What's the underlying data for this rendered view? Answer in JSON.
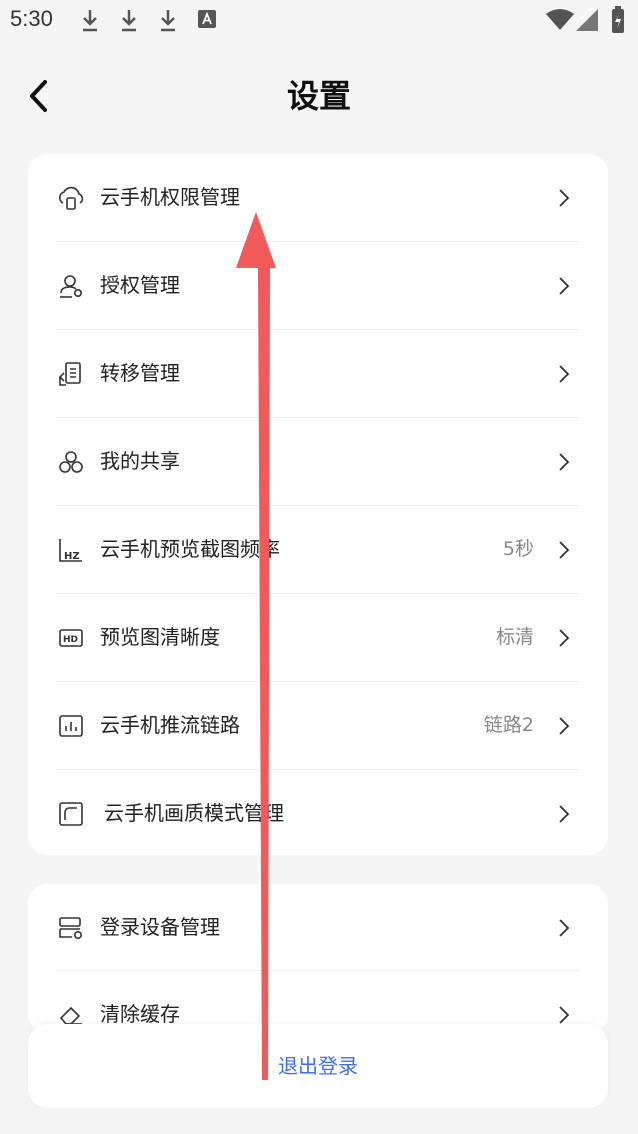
{
  "status_bar": {
    "time": "5:30",
    "icons": [
      "download-icon",
      "download-icon",
      "download-icon",
      "a-badge-icon",
      "wifi-icon",
      "signal-icon",
      "battery-icon"
    ]
  },
  "header": {
    "title": "设置",
    "back_icon": "chevron-left-icon"
  },
  "settings_group_1": [
    {
      "icon": "cloud-phone-icon",
      "label": "云手机权限管理",
      "value": ""
    },
    {
      "icon": "user-settings-icon",
      "label": "授权管理",
      "value": ""
    },
    {
      "icon": "transfer-icon",
      "label": "转移管理",
      "value": ""
    },
    {
      "icon": "share-icon",
      "label": "我的共享",
      "value": ""
    },
    {
      "icon": "hz-frequency-icon",
      "label": "云手机预览截图频率",
      "value": "5秒"
    },
    {
      "icon": "hd-icon",
      "label": "预览图清晰度",
      "value": "标清"
    },
    {
      "icon": "chart-link-icon",
      "label": "云手机推流链路",
      "value": "链路2"
    },
    {
      "icon": "quality-mode-icon",
      "label": "云手机画质模式管理",
      "value": ""
    }
  ],
  "settings_group_2": [
    {
      "icon": "device-login-icon",
      "label": "登录设备管理",
      "value": ""
    },
    {
      "icon": "eraser-icon",
      "label": "清除缓存",
      "value": ""
    }
  ],
  "logout": {
    "label": "退出登录"
  },
  "colors": {
    "background": "#f5f5f5",
    "card": "#ffffff",
    "accent_link": "#3c6ef0",
    "arrow": "#f25a5a"
  },
  "overlay": {
    "gesture": "swipe-up-arrow"
  }
}
